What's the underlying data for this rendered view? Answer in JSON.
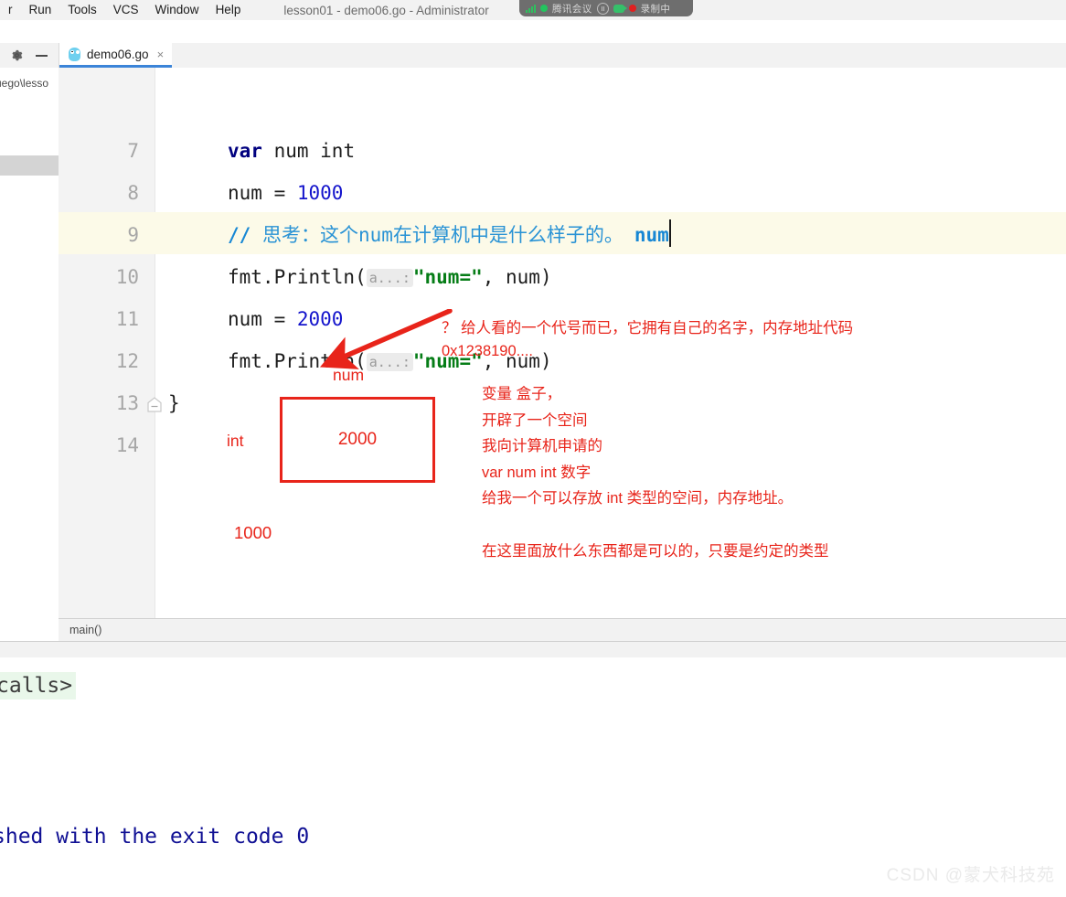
{
  "window": {
    "title": "lesson01 - demo06.go - Administrator"
  },
  "menu": {
    "items": [
      {
        "label": "r"
      },
      {
        "label": "Run"
      },
      {
        "label": "Tools"
      },
      {
        "label": "VCS"
      },
      {
        "label": "Window"
      },
      {
        "label": "Help"
      }
    ]
  },
  "float_bar": {
    "app_name": "腾讯会议",
    "status": "录制中"
  },
  "tabs": {
    "active": "demo06.go",
    "close_glyph": "×"
  },
  "project_panel": {
    "path_fragment": "uego\\lesso"
  },
  "editor": {
    "lines": [
      {
        "number": "7",
        "highlighted": false
      },
      {
        "number": "8",
        "highlighted": false
      },
      {
        "number": "9",
        "highlighted": true
      },
      {
        "number": "10",
        "highlighted": false
      },
      {
        "number": "11",
        "highlighted": false
      },
      {
        "number": "12",
        "highlighted": false
      },
      {
        "number": "13",
        "highlighted": false
      },
      {
        "number": "14",
        "highlighted": false
      }
    ],
    "code": {
      "l7_kw": "var",
      "l7_rest": " num int",
      "l8_a": "num = ",
      "l8_num": "1000",
      "l9_slashes": "//",
      "l9_comment": " 思考：这个num在计算机中是什么样子的。",
      "l9_tail": "num",
      "l10_call": "fmt.Println(",
      "l10_hint": "a...:",
      "l10_str": "\"num=\"",
      "l10_tail": ", num)",
      "l11_a": "num = ",
      "l11_num": "2000",
      "l12_call": "fmt.Println(",
      "l12_hint": "a...:",
      "l12_str": "\"num=\"",
      "l12_tail": ", num)",
      "l13_brace": "}"
    }
  },
  "annotations": {
    "arrow_note_line1": "？ 给人看的一个代号而已，它拥有自己的名字，内存地址代码",
    "arrow_note_line2": "0x1238190....",
    "box_label_top": "num",
    "box_label_left": "int",
    "box_value": "2000",
    "old_value": "1000",
    "notes": [
      "变量 盒子，",
      "开辟了一个空间",
      "我向计算机申请的",
      "var num int  数字",
      "给我一个可以存放 int 类型的空间，内存地址。"
    ],
    "note_last": "在这里面放什么东西都是可以的，只要是约定的类型",
    "accent_color": "#e8241a"
  },
  "breadcrumb": {
    "label": "main()"
  },
  "console": {
    "calls_text": "calls>",
    "exit_text": "shed with the exit code 0"
  },
  "watermark": {
    "text": "CSDN @蒙犬科技苑"
  }
}
